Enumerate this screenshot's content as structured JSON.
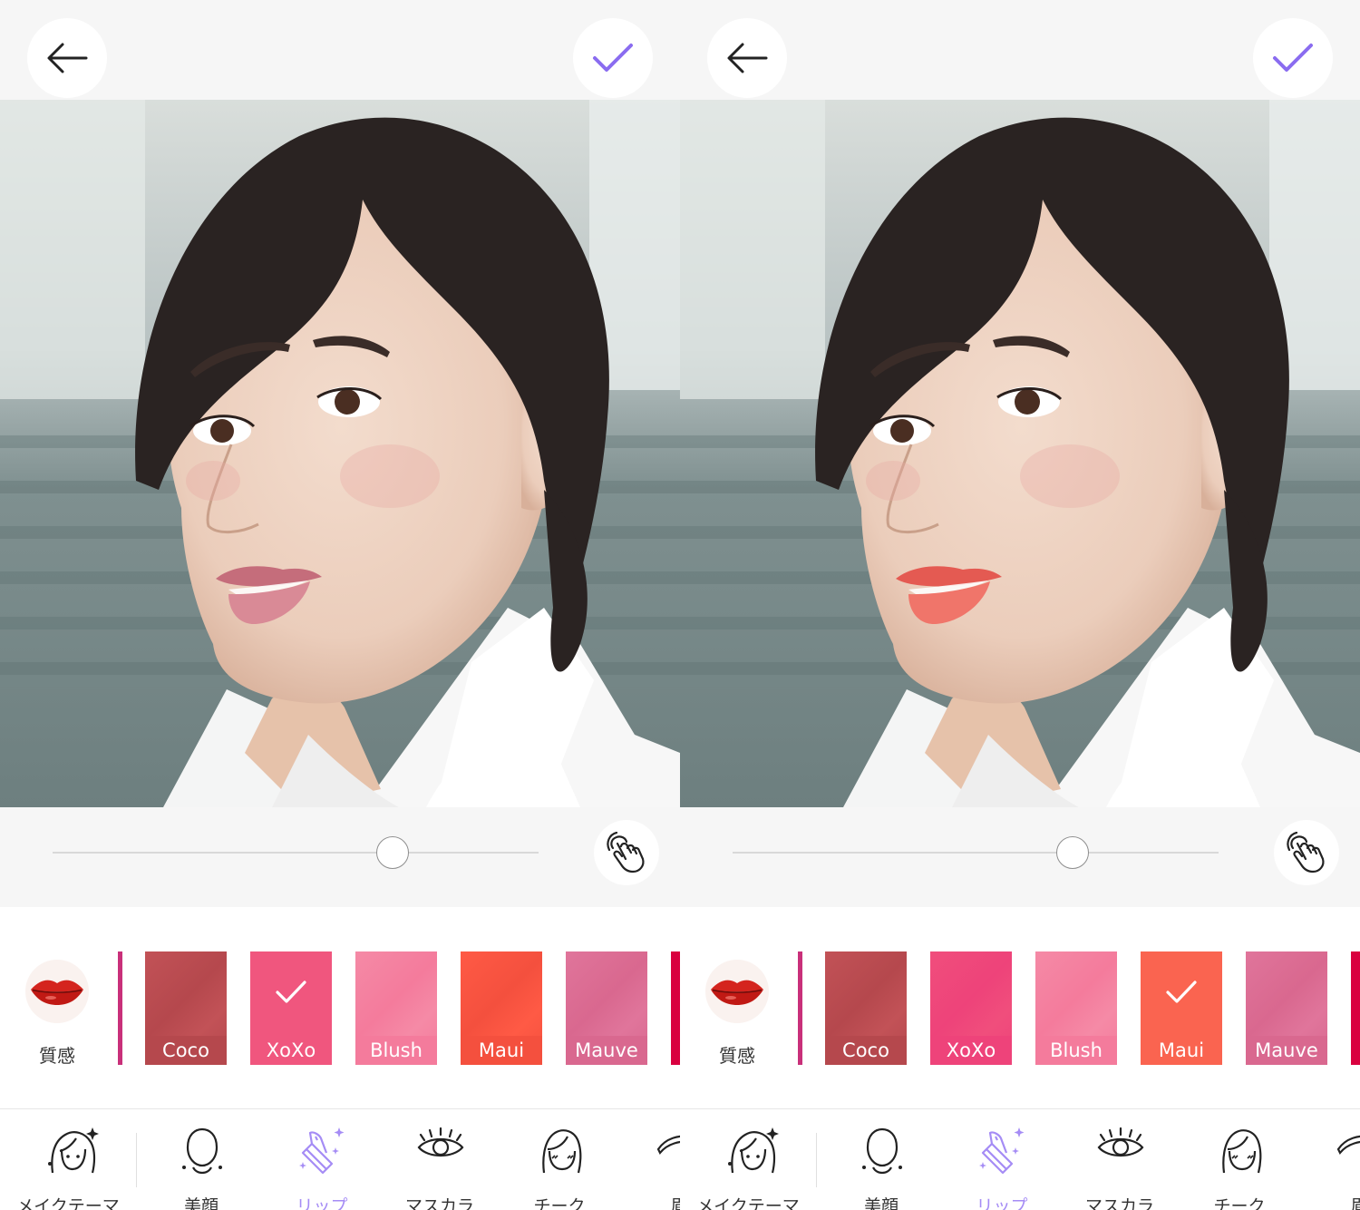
{
  "panels": [
    {
      "id": "before",
      "lip_color": "#d98a96",
      "lip_color_dark": "#c56d7b",
      "slider_value_percent": 70,
      "swatches": [
        {
          "name": "Coco",
          "color": "#c25257",
          "label_bg": "#b5484d",
          "selected": false
        },
        {
          "name": "XoXo",
          "color": "#f0567e",
          "label_bg": "#f0567e",
          "selected": true
        },
        {
          "name": "Blush",
          "color": "#f58aa6",
          "label_bg": "#f47b9c",
          "selected": false
        },
        {
          "name": "Maui",
          "color": "#ff5a45",
          "label_bg": "#f4503e",
          "selected": false
        },
        {
          "name": "Mauve",
          "color": "#e0759b",
          "label_bg": "#d9688f",
          "selected": false
        }
      ],
      "edge_left_color": "#c9307a",
      "edge_right_color": "#d9003f"
    },
    {
      "id": "after",
      "lip_color": "#f0756a",
      "lip_color_dark": "#e45a52",
      "slider_value_percent": 70,
      "swatches": [
        {
          "name": "Coco",
          "color": "#c25257",
          "label_bg": "#b5484d",
          "selected": false
        },
        {
          "name": "XoXo",
          "color": "#f04e7c",
          "label_bg": "#ee437a",
          "selected": false
        },
        {
          "name": "Blush",
          "color": "#f58aa6",
          "label_bg": "#f47b9c",
          "selected": false
        },
        {
          "name": "Maui",
          "color": "#fa6450",
          "label_bg": "#fa6450",
          "selected": true
        },
        {
          "name": "Mauve",
          "color": "#e0759b",
          "label_bg": "#d9688f",
          "selected": false
        }
      ],
      "edge_left_color": "#c9307a",
      "edge_right_color": "#d9003f"
    }
  ],
  "texture_label": "質感",
  "tabs": [
    {
      "label": "メイクテーマ",
      "icon": "face-sparkle-icon",
      "active": false
    },
    {
      "label": "美顔",
      "icon": "face-outline-icon",
      "active": false
    },
    {
      "label": "リップ",
      "icon": "lipstick-icon",
      "active": true
    },
    {
      "label": "マスカラ",
      "icon": "eye-lash-icon",
      "active": false
    },
    {
      "label": "チーク",
      "icon": "cheek-face-icon",
      "active": false
    },
    {
      "label": "眉",
      "icon": "eyebrow-icon",
      "active": false
    }
  ],
  "colors": {
    "accent": "#a58cf5",
    "check": "#8a6cf0",
    "bar_bg": "#f6f6f6"
  }
}
